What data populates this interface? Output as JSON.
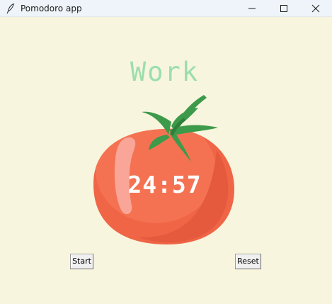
{
  "window": {
    "title": "Pomodoro app",
    "icons": {
      "app": "feather-icon",
      "minimize": "minimize-icon",
      "maximize": "maximize-icon",
      "close": "close-icon"
    }
  },
  "main": {
    "mode_label": "Work",
    "timer": "24:57",
    "start_label": "Start",
    "reset_label": "Reset",
    "image": "tomato-icon"
  },
  "colors": {
    "background": "#f7f5dd",
    "mode_label": "#9bdeac",
    "timer_text": "#ffffff",
    "tomato": "#ef6546",
    "leaves": "#3d9a4a"
  }
}
